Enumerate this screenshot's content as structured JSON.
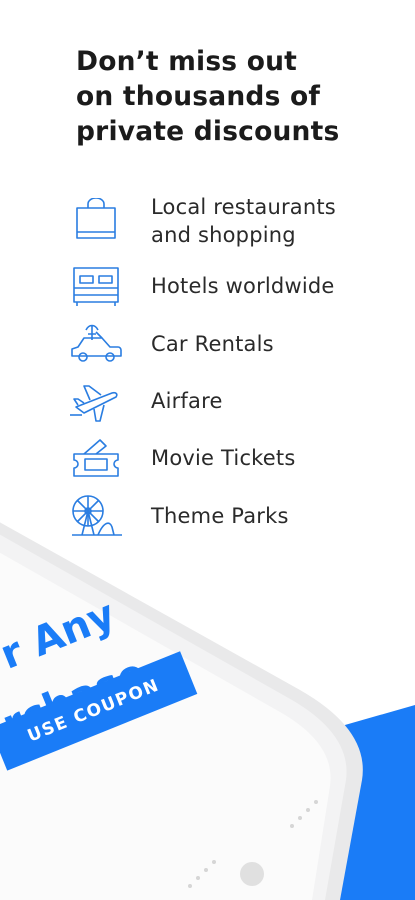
{
  "headline": [
    "Don’t miss out",
    "on thousands of",
    "private discounts"
  ],
  "features": [
    {
      "icon": "shopping-bag-icon",
      "lines": [
        "Local restaurants",
        "and shopping"
      ]
    },
    {
      "icon": "bed-icon",
      "lines": [
        "Hotels worldwide"
      ]
    },
    {
      "icon": "car-icon",
      "lines": [
        "Car Rentals"
      ]
    },
    {
      "icon": "airplane-icon",
      "lines": [
        "Airfare"
      ]
    },
    {
      "icon": "ticket-icon",
      "lines": [
        "Movie Tickets"
      ]
    },
    {
      "icon": "ferris-wheel-icon",
      "lines": [
        "Theme Parks"
      ]
    }
  ],
  "promo": {
    "line1": "r Any",
    "line2": "rchase",
    "button_label": "USE COUPON"
  },
  "colors": {
    "accent": "#1a7cf7",
    "icon": "#2a7de1",
    "text": "#1b1b1b"
  }
}
